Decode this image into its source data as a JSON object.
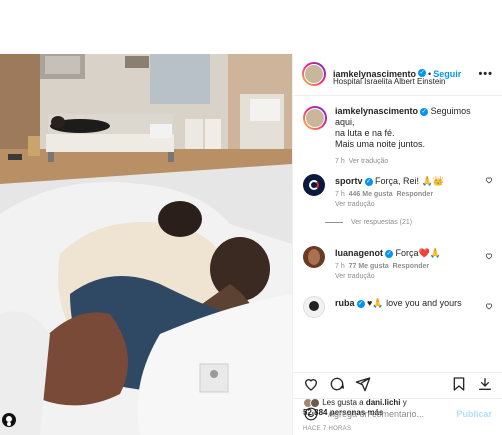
{
  "post": {
    "author": "iamkelynascimento",
    "follow_label": "Seguir",
    "dot": "•",
    "location": "Hospital Israelita Albert Einstein",
    "more_label": "•••"
  },
  "caption": {
    "user": "iamkelynascimento",
    "text_line1": "Seguimos aqui,",
    "text_line2": "na luta e na fé.",
    "text_line3": "Mais uma noite juntos.",
    "age": "7 h",
    "translate": "Ver tradução"
  },
  "comments": [
    {
      "user": "sportv",
      "text": "Força, Rei! 🙏👑",
      "age": "7 h",
      "likes": "446 Me gusta",
      "reply": "Responder",
      "translate": "Ver tradução",
      "view_replies": "Ver respuestas (21)"
    },
    {
      "user": "luanagenot",
      "text": "Força❤️🙏",
      "age": "7 h",
      "likes": "77 Me gusta",
      "reply": "Responder",
      "translate": "Ver tradução"
    },
    {
      "user": "ruba",
      "text": "♥🙏 love you and yours"
    }
  ],
  "likes": {
    "prefix": "Les gusta a ",
    "user": "dani.lichi",
    "mid": " y",
    "count": "52.884 personas más"
  },
  "timestamp": "HACE 7 HORAS",
  "add_comment": {
    "placeholder": "Agrega un comentario...",
    "publish": "Publicar"
  },
  "colors": {
    "accent": "#0095f6",
    "verified": "#0095f6",
    "muted": "#8e8e8e",
    "heart_red": "#ed4956",
    "publish_disabled": "#b2dffc"
  },
  "icons": [
    "heart-icon",
    "comment-icon",
    "share-icon",
    "bookmark-icon",
    "emoji-icon",
    "verified-icon",
    "more-icon",
    "tag-user-icon"
  ]
}
